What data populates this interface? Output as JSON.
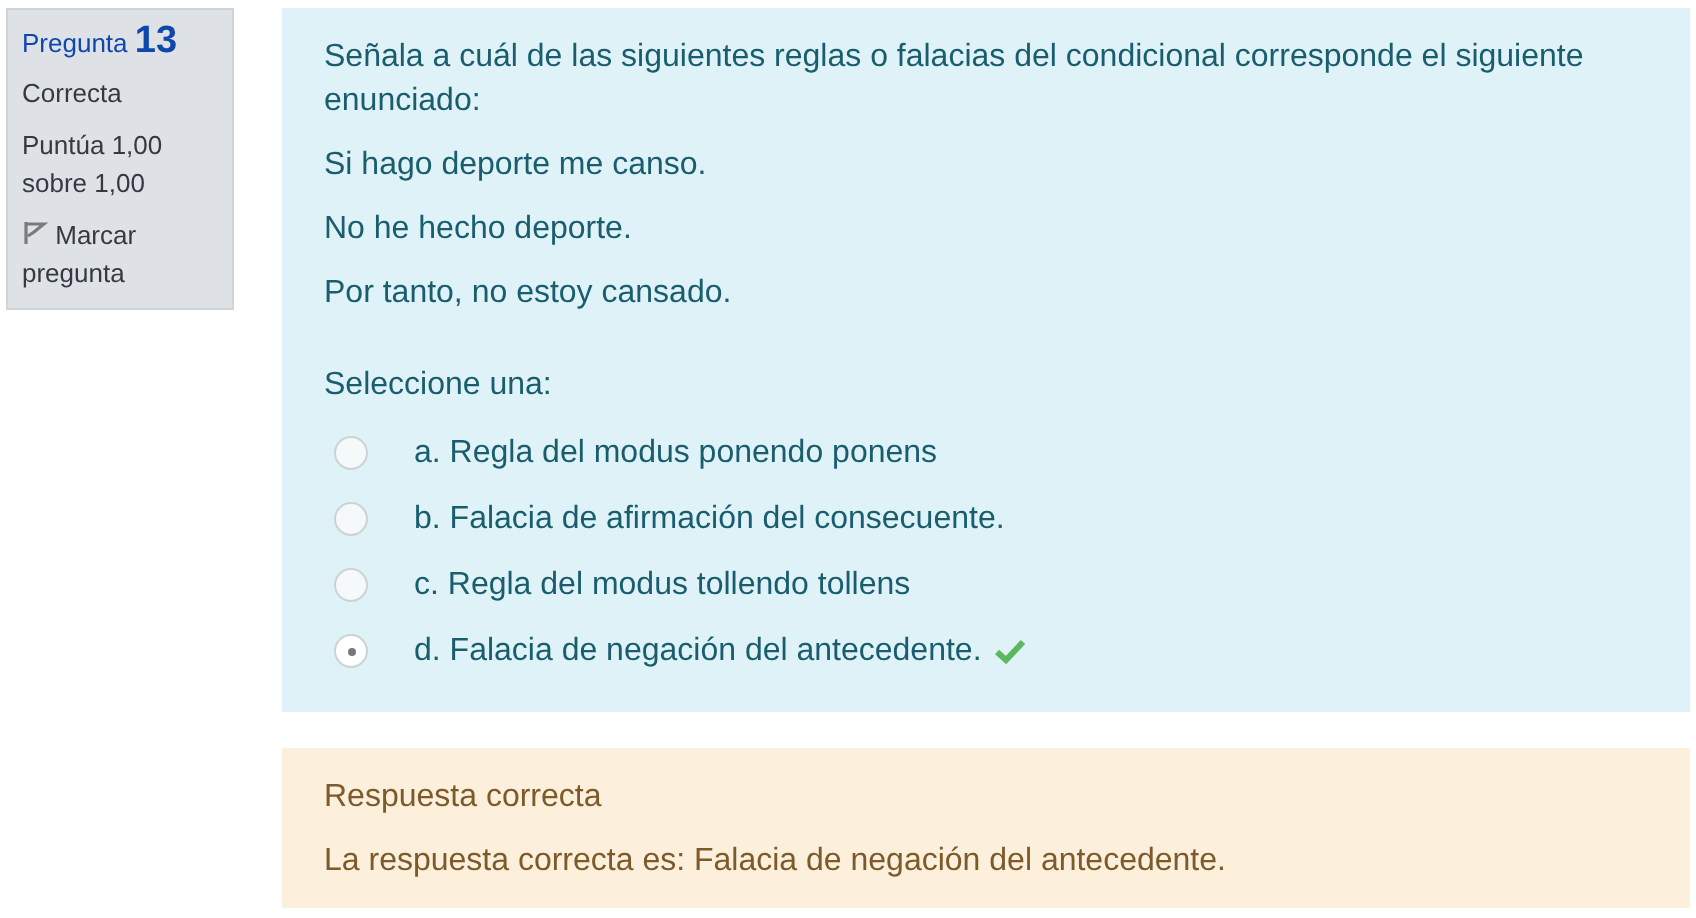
{
  "info": {
    "label": "Pregunta",
    "number": "13",
    "state": "Correcta",
    "grade": "Puntúa 1,00 sobre 1,00",
    "flag": "Marcar pregunta"
  },
  "question": {
    "paragraphs": [
      "Señala a cuál de las siguientes reglas o falacias del condicional corresponde el siguiente enunciado:",
      "Si hago deporte me canso.",
      "No he hecho deporte.",
      "Por tanto, no estoy cansado."
    ],
    "prompt": "Seleccione una:",
    "options": [
      {
        "label": "a. Regla del modus ponendo ponens",
        "selected": false,
        "correct": false
      },
      {
        "label": "b. Falacia de afirmación del consecuente.",
        "selected": false,
        "correct": false
      },
      {
        "label": "c. Regla del modus tollendo tollens",
        "selected": false,
        "correct": false
      },
      {
        "label": "d. Falacia de negación del antecedente.",
        "selected": true,
        "correct": true
      }
    ]
  },
  "feedback": {
    "title": "Respuesta correcta",
    "text": "La respuesta correcta es: Falacia de negación del antecedente."
  }
}
